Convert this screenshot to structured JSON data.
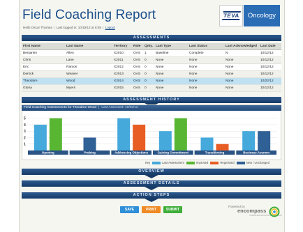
{
  "header": {
    "title": "Field Coaching Report",
    "greeting": "Hello Oscar Thomas",
    "last_logged": "Last logged in: 10/19/12 at 8:55",
    "logout": "Logout",
    "teva_logo": "TEVA",
    "brand": "Oncology"
  },
  "sections": {
    "assessments": "ASSESSMENTS",
    "history": "ASSESSMENT HISTORY",
    "overview": "OVERVIEW",
    "details": "ASSESSMENT DETAILS",
    "actions": "ACTION STEPS"
  },
  "table": {
    "columns": [
      "First Name",
      "Last Name",
      "Territory",
      "Role",
      "Qnty.",
      "Last Type",
      "Last Status",
      "Last Acknowledged",
      "Last Date"
    ],
    "rows": [
      [
        "Benjamin",
        "Allen",
        "X2010",
        "OAS",
        "1",
        "Baseline",
        "Complete",
        "N",
        "10/12/12"
      ],
      [
        "Chris",
        "Lane",
        "X2011",
        "OAS",
        "0",
        "None",
        "None",
        "None",
        "10/12/12"
      ],
      [
        "Eric",
        "Ramos",
        "X2012",
        "OAS",
        "0",
        "None",
        "None",
        "None",
        "10/12/12"
      ],
      [
        "Derrick",
        "Weaver",
        "X2013",
        "OAS",
        "0",
        "None",
        "None",
        "None",
        "10/12/12"
      ],
      [
        "Theodore",
        "Wood",
        "X2014",
        "OAS",
        "0",
        "None",
        "None",
        "None",
        "10/22/12"
      ],
      [
        "Gloria",
        "Myers",
        "X2015",
        "OAS",
        "0",
        "None",
        "None",
        "None",
        "10/12/12"
      ]
    ],
    "selected_index": 4
  },
  "chart_panel": {
    "heading": "Field Coaching Assessments for Theodore Wood",
    "last_assessed": "Last Assessed: 10/02/12"
  },
  "legend": {
    "key": "Key",
    "items": [
      "Last Assessment",
      "Improved",
      "Regressed",
      "New / Unchanged"
    ]
  },
  "colors": {
    "last_assessment": "#45a9dc",
    "improved": "#58b632",
    "regressed": "#e85d23",
    "unchanged": "#2f6096"
  },
  "chart_data": {
    "type": "bar",
    "categories": [
      "Opening",
      "Probing",
      "Addressing Objections",
      "Gaining Commitment",
      "Transitioning",
      "Business Acumen"
    ],
    "series": [
      {
        "values": [
          4,
          null,
          5,
          3,
          2,
          3
        ]
      },
      {
        "values": [
          5,
          null,
          null,
          5,
          null,
          null
        ]
      },
      {
        "values": [
          null,
          null,
          4,
          null,
          1,
          null
        ]
      },
      {
        "values": [
          null,
          2,
          null,
          null,
          null,
          3
        ]
      }
    ],
    "y_ticks": [
      "5",
      "4",
      "3",
      "2",
      "1"
    ],
    "ylim": [
      0,
      5.4
    ]
  },
  "buttons": {
    "save": "SAVE",
    "print": "PRINT",
    "submit": "SUBMIT"
  },
  "footer": {
    "powered_by": "Powered by",
    "brand": "encompass",
    "brand_sub": "COMMUNICATIONS & LEARNING"
  }
}
